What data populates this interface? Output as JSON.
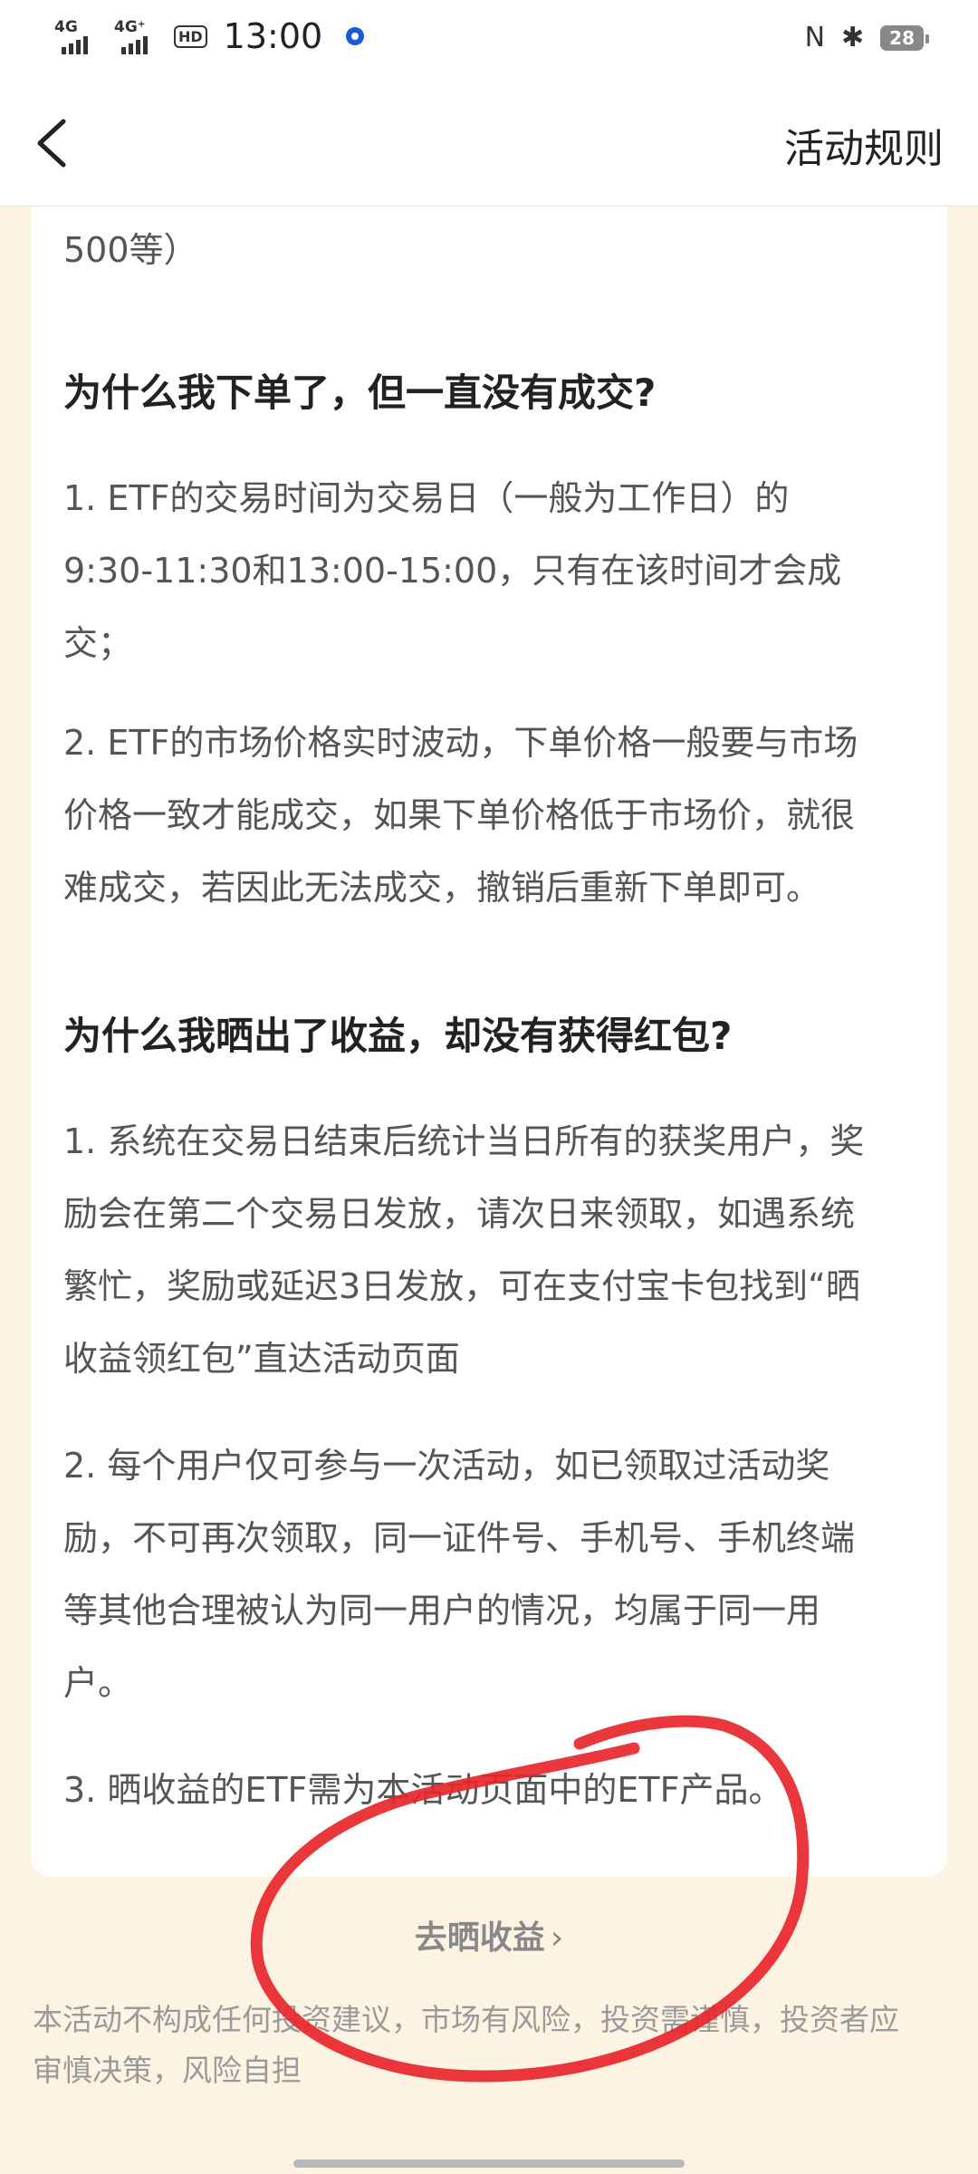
{
  "status_bar": {
    "signal1": "4G",
    "signal2": "4G⁺",
    "hd": "HD",
    "time": "13:00",
    "nfc": "N",
    "bluetooth": "✱",
    "battery": "28"
  },
  "nav": {
    "title": "活动规则"
  },
  "content": {
    "cut_off_text": "500等）",
    "section1": {
      "heading": "为什么我下单了，但一直没有成交?",
      "items": [
        {
          "line1": "1.  ETF的交易时间为交易日（一般为工作日）的",
          "line2": "9:30-11:30和13:00-15:00，只有在该时间才会成",
          "line3": "交；"
        },
        {
          "line1": "2.  ETF的市场价格实时波动，下单价格一般要与市场",
          "line2": "价格一致才能成交，如果下单价格低于市场价，就很",
          "line3": "难成交，若因此无法成交，撤销后重新下单即可。"
        }
      ]
    },
    "section2": {
      "heading": "为什么我晒出了收益，却没有获得红包?",
      "items": [
        {
          "line1": "1.  系统在交易日结束后统计当日所有的获奖用户，奖",
          "line2": "励会在第二个交易日发放，请次日来领取，如遇系统",
          "line3": "繁忙，奖励或延迟3日发放，可在支付宝卡包找到“晒",
          "line4": "收益领红包”直达活动页面"
        },
        {
          "line1": "2.  每个用户仅可参与一次活动，如已领取过活动奖",
          "line2": "励，不可再次领取，同一证件号、手机号、手机终端",
          "line3": "等其他合理被认为同一用户的情况，均属于同一用",
          "line4": "户。"
        },
        {
          "line1": "3.  晒收益的ETF需为本活动页面中的ETF产品。"
        }
      ]
    }
  },
  "cta": {
    "label": "去晒收益",
    "chevron": "›"
  },
  "disclaimer": {
    "line1": "本活动不构成任何投资建议，市场有风险，投资需谨慎，投资者应",
    "line2": "审慎决策，风险自担"
  },
  "colors": {
    "page_background": "#fdf3e3",
    "card_background": "#ffffff",
    "annotation_red": "#e8262b"
  }
}
